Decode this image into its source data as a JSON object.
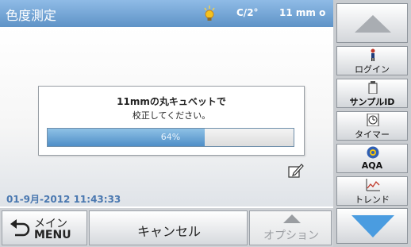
{
  "header": {
    "title": "色度測定",
    "condition": "C/2°",
    "cuvette": "11 mm o"
  },
  "dialog": {
    "line1": "11mmの丸キュベットで",
    "line2": "校正してください。",
    "progress": 64,
    "progress_text": "64%"
  },
  "status": {
    "datetime": "01-9月-2012 11:43:33"
  },
  "bottom": {
    "main_jp": "メイン",
    "main_en": "MENU",
    "cancel": "キャンセル",
    "option": "オプション"
  },
  "sidebar": {
    "tools": [
      {
        "label": "ログイン",
        "icon": "person-icon"
      },
      {
        "label": "サンプルID",
        "icon": "sample-bottle-icon"
      },
      {
        "label": "タイマー",
        "icon": "timer-icon"
      },
      {
        "label": "AQA",
        "icon": "aqa-icon"
      },
      {
        "label": "トレンド",
        "icon": "trend-chart-icon"
      }
    ]
  },
  "colors": {
    "title_bar": "#7aaedc",
    "accent": "#4a78b0",
    "progress": "#4f8ec7"
  }
}
